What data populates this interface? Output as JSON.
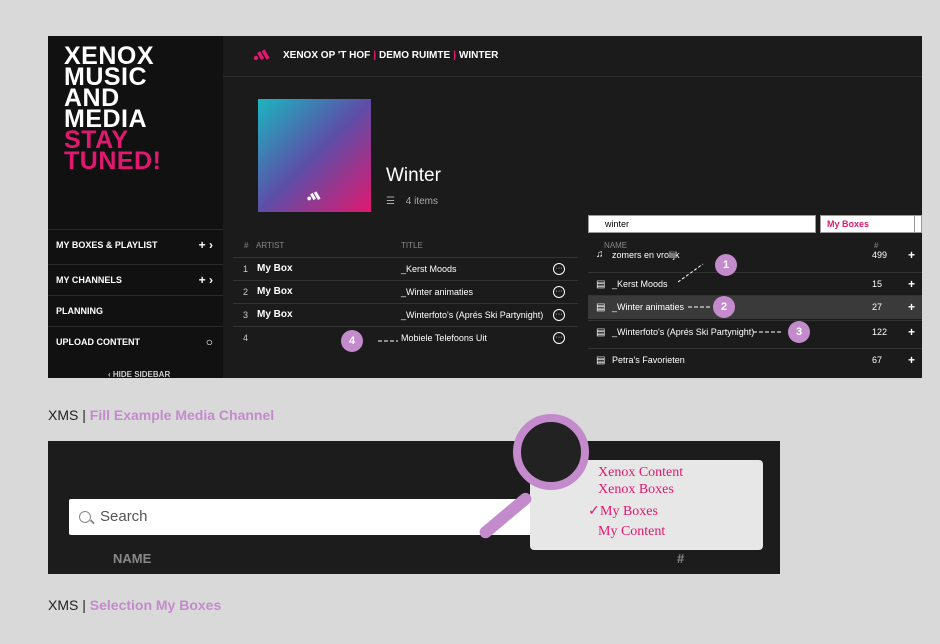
{
  "app": {
    "logo_lines": [
      "XENOX",
      "MUSIC",
      "AND",
      "MEDIA"
    ],
    "logo_pink_lines": [
      "STAY",
      "TUNED!"
    ]
  },
  "sidebar": {
    "items": [
      {
        "label": "MY BOXES & PLAYLIST",
        "actions": "+  ›"
      },
      {
        "label": "MY CHANNELS",
        "actions": "+  ›"
      },
      {
        "label": "PLANNING",
        "actions": ""
      },
      {
        "label": "UPLOAD CONTENT",
        "actions": "○"
      }
    ],
    "hide_label": "‹ HIDE SIDEBAR"
  },
  "header": {
    "crumb_1": "XENOX OP 'T HOF",
    "crumb_2": "DEMO RUIMTE",
    "crumb_3": "WINTER",
    "separator": "|"
  },
  "playlist": {
    "title": "Winter",
    "count": "4 items",
    "count_icon": "☰",
    "columns": {
      "num": "#",
      "artist": "ARTIST",
      "title": "TITLE"
    },
    "rows": [
      {
        "n": "1",
        "artist": "My Box",
        "title": "_Kerst Moods"
      },
      {
        "n": "2",
        "artist": "My Box",
        "title": "_Winter animaties"
      },
      {
        "n": "3",
        "artist": "My Box",
        "title": "_Winterfoto's (Aprés Ski Partynight)"
      },
      {
        "n": "4",
        "artist": "",
        "title": "Mobiele Telefoons Uit"
      }
    ],
    "more_glyph": "···"
  },
  "content_panel": {
    "search_value": "winter",
    "select_value": "My Boxes",
    "columns": {
      "name": "NAME",
      "count": "#"
    },
    "rows": [
      {
        "icon": "♫",
        "name": "zomers en vrolijk",
        "count": "499"
      },
      {
        "icon": "▤",
        "name": "_Kerst Moods",
        "count": "15"
      },
      {
        "icon": "▤",
        "name": "_Winter animaties",
        "count": "27"
      },
      {
        "icon": "▤",
        "name": "_Winterfoto's (Aprés Ski Partynight)",
        "count": "122"
      },
      {
        "icon": "▤",
        "name": "Petra's Favorieten",
        "count": "67"
      }
    ],
    "add_glyph": "+"
  },
  "badges": [
    "1",
    "2",
    "3",
    "4"
  ],
  "caption1": {
    "prefix": "XMS | ",
    "highlight": "Fill Example Media Channel"
  },
  "caption2": {
    "prefix": "XMS | ",
    "highlight": "Selection My Boxes"
  },
  "zoom": {
    "search_placeholder": "Search",
    "name_header": "NAME",
    "count_header": "#",
    "menu_items": [
      "Xenox Content",
      "Xenox Boxes",
      "My Boxes",
      "My Content"
    ],
    "checked_index": 2,
    "check_glyph": "✓"
  },
  "colors": {
    "brand": "#e1186f",
    "accent": "#c48bcc"
  }
}
